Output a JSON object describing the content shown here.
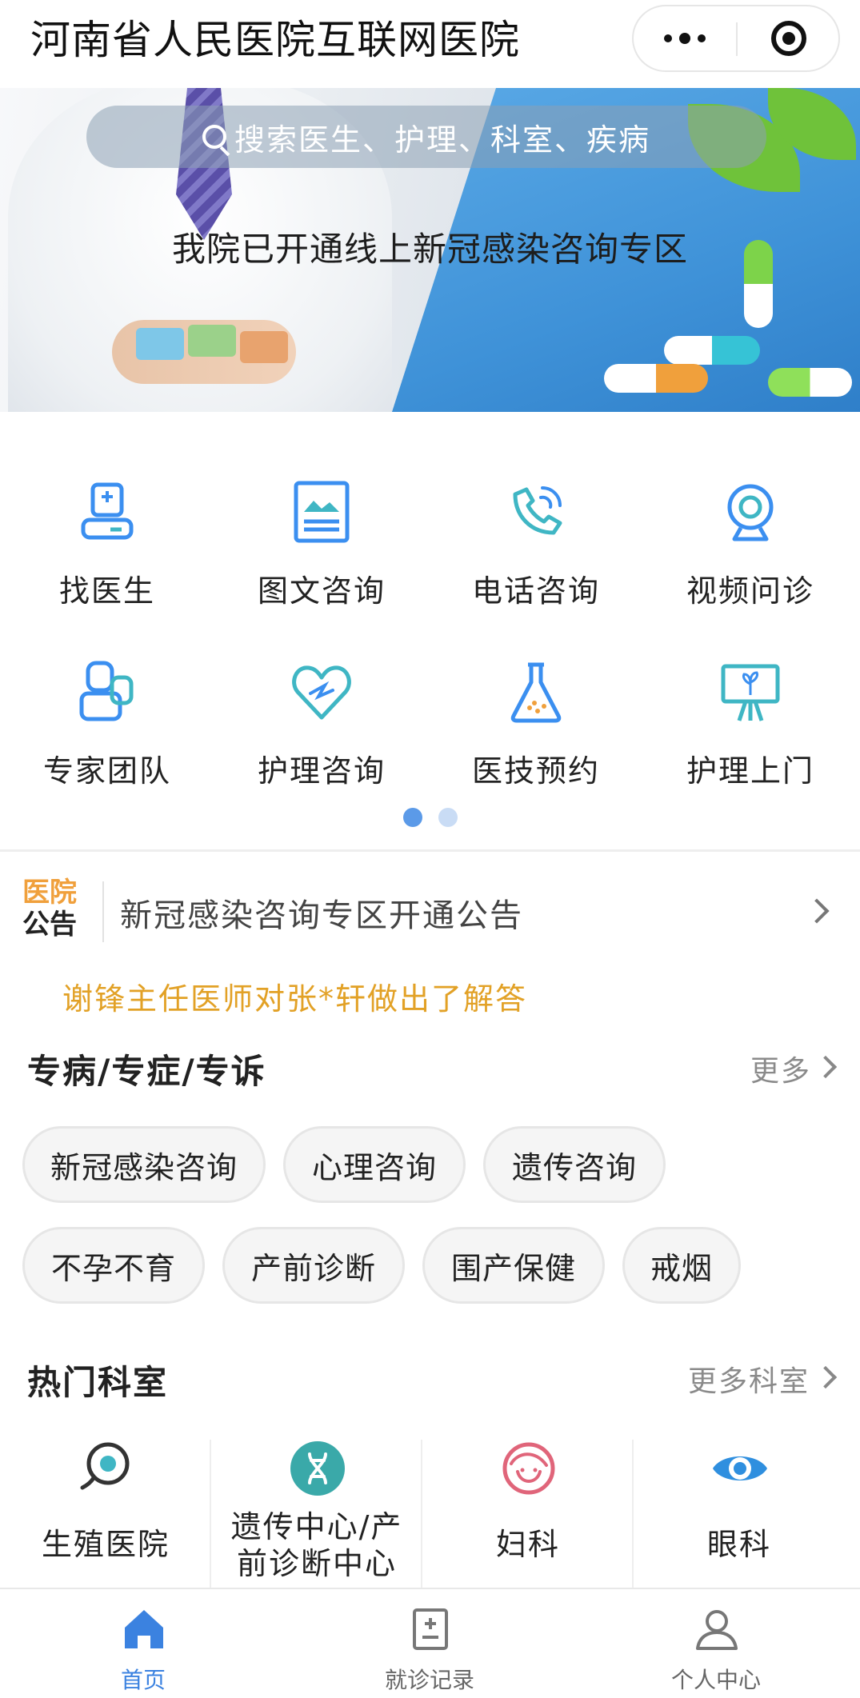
{
  "header": {
    "title": "河南省人民医院互联网医院"
  },
  "banner": {
    "search_placeholder": "搜索医生、护理、科室、疾病",
    "headline": "我院已开通线上新冠感染咨询专区"
  },
  "services": [
    {
      "label": "找医生",
      "icon": "doctor-icon"
    },
    {
      "label": "图文咨询",
      "icon": "image-text-icon"
    },
    {
      "label": "电话咨询",
      "icon": "phone-icon"
    },
    {
      "label": "视频问诊",
      "icon": "webcam-icon"
    },
    {
      "label": "专家团队",
      "icon": "team-icon"
    },
    {
      "label": "护理咨询",
      "icon": "heart-icon"
    },
    {
      "label": "医技预约",
      "icon": "flask-icon"
    },
    {
      "label": "护理上门",
      "icon": "easel-icon"
    }
  ],
  "pager": {
    "pages": 2,
    "current": 1
  },
  "notice": {
    "tag_line1": "医院",
    "tag_line2": "公告",
    "text": "新冠感染咨询专区开通公告"
  },
  "reply_text": "谢锋主任医师对张*轩做出了解答",
  "special": {
    "title": "专病/专症/专诉",
    "more": "更多",
    "chips": [
      "新冠感染咨询",
      "心理咨询",
      "遗传咨询",
      "不孕不育",
      "产前诊断",
      "围产保健",
      "戒烟"
    ]
  },
  "departments": {
    "title": "热门科室",
    "more": "更多科室",
    "items": [
      {
        "label": "生殖医院",
        "icon": "reproduction-icon"
      },
      {
        "label_line1": "遗传中心/产",
        "label_line2": "前诊断中心",
        "icon": "dna-icon"
      },
      {
        "label": "妇科",
        "icon": "woman-icon"
      },
      {
        "label": "眼科",
        "icon": "eye-icon"
      }
    ]
  },
  "tabbar": {
    "items": [
      {
        "label": "首页",
        "icon": "home-icon",
        "active": true
      },
      {
        "label": "就诊记录",
        "icon": "record-icon",
        "active": false
      },
      {
        "label": "个人中心",
        "icon": "user-icon",
        "active": false
      }
    ]
  },
  "colors": {
    "accent_blue": "#3b82e0",
    "teal": "#2fb3b3",
    "orange": "#f0a03c",
    "reply_gold": "#e2a126"
  }
}
